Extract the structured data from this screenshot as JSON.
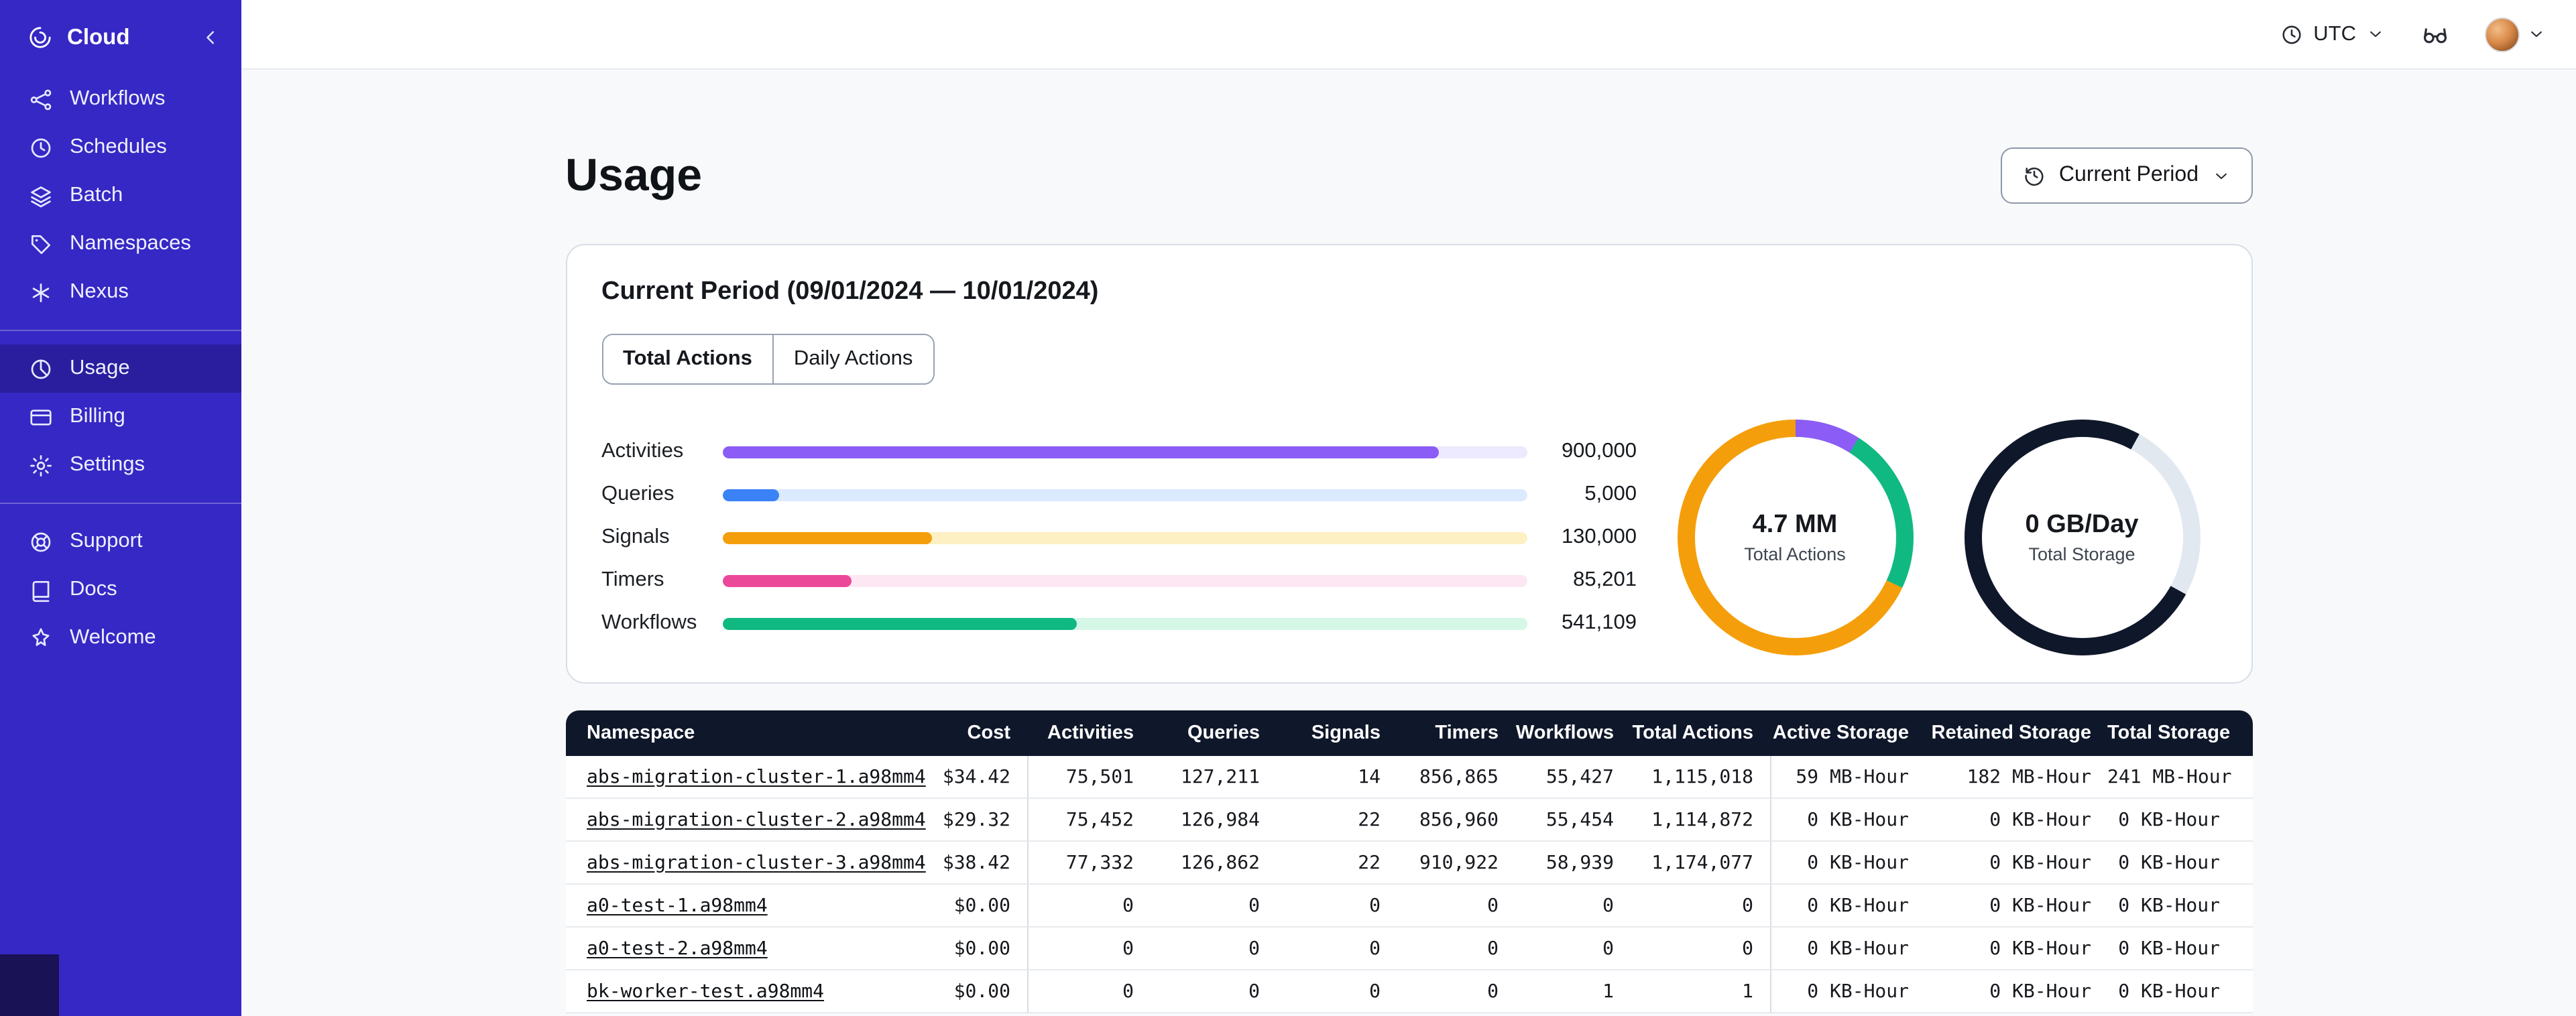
{
  "colors": {
    "sidebar_bg": "#3628C4",
    "sidebar_active_bg": "#2A1E9E",
    "sidebar_footer_bg": "#191254",
    "table_header_bg": "#0F172A",
    "page_bg": "#F8F9FB",
    "card_border": "#D8DEE6"
  },
  "sidebar": {
    "brand": {
      "label": "Cloud",
      "logo_icon": "temporal-logo",
      "collapse_icon": "chevron-left"
    },
    "groups": [
      {
        "items": [
          {
            "label": "Workflows",
            "icon": "workflows"
          },
          {
            "label": "Schedules",
            "icon": "schedules"
          },
          {
            "label": "Batch",
            "icon": "batch"
          },
          {
            "label": "Namespaces",
            "icon": "namespaces"
          },
          {
            "label": "Nexus",
            "icon": "nexus"
          }
        ]
      },
      {
        "items": [
          {
            "label": "Usage",
            "icon": "usage",
            "active": true
          },
          {
            "label": "Billing",
            "icon": "billing"
          },
          {
            "label": "Settings",
            "icon": "settings"
          }
        ]
      },
      {
        "items": [
          {
            "label": "Support",
            "icon": "support"
          },
          {
            "label": "Docs",
            "icon": "docs"
          },
          {
            "label": "Welcome",
            "icon": "welcome"
          }
        ]
      }
    ]
  },
  "topbar": {
    "timezone": {
      "icon": "clock",
      "label": "UTC",
      "chevron_icon": "chevron-down"
    },
    "glasses_icon": "glasses",
    "avatar_chevron_icon": "chevron-down"
  },
  "page": {
    "title": "Usage",
    "period_button": {
      "icon": "history",
      "label": "Current Period",
      "chevron_icon": "chevron-down"
    }
  },
  "usage_card": {
    "title": "Current Period (09/01/2024 — 10/01/2024)",
    "tabs": [
      {
        "label": "Total Actions",
        "active": true
      },
      {
        "label": "Daily Actions",
        "active": false
      }
    ]
  },
  "chart_data": [
    {
      "type": "bar",
      "orientation": "horizontal",
      "categories": [
        "Activities",
        "Queries",
        "Signals",
        "Timers",
        "Workflows"
      ],
      "values": [
        900000,
        5000,
        130000,
        85201,
        541109
      ],
      "value_labels": [
        "900,000",
        "5,000",
        "130,000",
        "85,201",
        "541,109"
      ],
      "bar_colors": [
        "#8b5cf6",
        "#3b82f6",
        "#f59e0b",
        "#ec4899",
        "#10b981"
      ],
      "track_colors": [
        "#ede9fe",
        "#dbeafe",
        "#fdf0c2",
        "#fce7f3",
        "#d4f7e7"
      ],
      "fill_percents": [
        89,
        7,
        26,
        16,
        44
      ],
      "grid": false,
      "legend": false
    },
    {
      "type": "pie",
      "subtype": "donut",
      "center_value": "4.7 MM",
      "center_label": "Total Actions",
      "slices": [
        {
          "color": "#8b5cf6",
          "pct": 9
        },
        {
          "color": "#10b981",
          "pct": 23
        },
        {
          "color": "#f59e0b",
          "pct": 68
        }
      ]
    },
    {
      "type": "pie",
      "subtype": "donut",
      "center_value": "0 GB/Day",
      "center_label": "Total Storage",
      "slices": [
        {
          "color": "#0f172a",
          "pct": 8
        },
        {
          "color": "#e2e8f0",
          "pct": 25
        },
        {
          "color": "#0f172a",
          "pct": 67
        }
      ]
    }
  ],
  "table": {
    "columns": [
      {
        "label": "Namespace",
        "align": "left"
      },
      {
        "label": "Cost",
        "align": "right"
      },
      {
        "label": "Activities",
        "align": "right",
        "divider": true
      },
      {
        "label": "Queries",
        "align": "right"
      },
      {
        "label": "Signals",
        "align": "right"
      },
      {
        "label": "Timers",
        "align": "right"
      },
      {
        "label": "Workflows",
        "align": "right"
      },
      {
        "label": "Total Actions",
        "align": "right"
      },
      {
        "label": "Active Storage",
        "align": "right",
        "divider": true
      },
      {
        "label": "Retained Storage",
        "align": "right"
      },
      {
        "label": "Total Storage",
        "align": "right"
      }
    ],
    "rows": [
      [
        "abs-migration-cluster-1.a98mm4",
        "$34.42",
        "75,501",
        "127,211",
        "14",
        "856,865",
        "55,427",
        "1,115,018",
        "59 MB-Hour",
        "182 MB-Hour",
        "241 MB-Hour"
      ],
      [
        "abs-migration-cluster-2.a98mm4",
        "$29.32",
        "75,452",
        "126,984",
        "22",
        "856,960",
        "55,454",
        "1,114,872",
        "0 KB-Hour",
        "0 KB-Hour",
        "0 KB-Hour"
      ],
      [
        "abs-migration-cluster-3.a98mm4",
        "$38.42",
        "77,332",
        "126,862",
        "22",
        "910,922",
        "58,939",
        "1,174,077",
        "0 KB-Hour",
        "0 KB-Hour",
        "0 KB-Hour"
      ],
      [
        "a0-test-1.a98mm4",
        "$0.00",
        "0",
        "0",
        "0",
        "0",
        "0",
        "0",
        "0 KB-Hour",
        "0 KB-Hour",
        "0 KB-Hour"
      ],
      [
        "a0-test-2.a98mm4",
        "$0.00",
        "0",
        "0",
        "0",
        "0",
        "0",
        "0",
        "0 KB-Hour",
        "0 KB-Hour",
        "0 KB-Hour"
      ],
      [
        "bk-worker-test.a98mm4",
        "$0.00",
        "0",
        "0",
        "0",
        "0",
        "1",
        "1",
        "0 KB-Hour",
        "0 KB-Hour",
        "0 KB-Hour"
      ]
    ]
  }
}
